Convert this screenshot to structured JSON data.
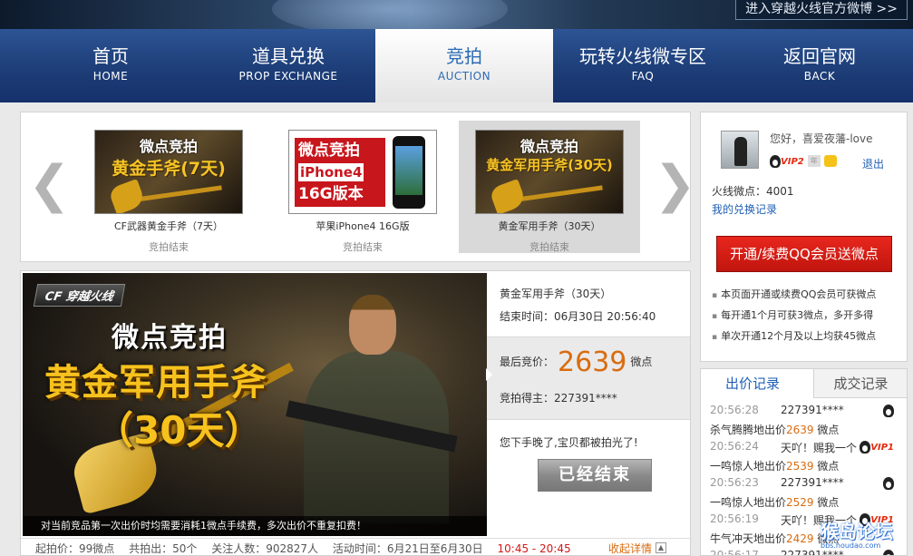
{
  "banner": {
    "weibo_link": "进入穿越火线官方微博 >>"
  },
  "nav": {
    "items": [
      {
        "zh": "首页",
        "en": "HOME"
      },
      {
        "zh": "道具兑换",
        "en": "PROP EXCHANGE"
      },
      {
        "zh": "竞拍",
        "en": "AUCTION"
      },
      {
        "zh": "玩转火线微专区",
        "en": "FAQ"
      },
      {
        "zh": "返回官网",
        "en": "BACK"
      }
    ],
    "active_index": 2
  },
  "products": [
    {
      "thumb_title": "微点竞拍",
      "thumb_sub": "黄金手斧(7天)",
      "name": "CF武器黄金手斧（7天）",
      "status": "竞拍结束"
    },
    {
      "thumb_title": "微点竞拍",
      "thumb_l2": "iPhone4",
      "thumb_l3": "16G版本",
      "name": "苹果iPhone4 16G版",
      "status": "竞拍结束"
    },
    {
      "thumb_title": "微点竞拍",
      "thumb_sub": "黄金军用手斧(30天)",
      "name": "黄金军用手斧（30天）",
      "status": "竞拍结束"
    }
  ],
  "hero": {
    "logo": "CF 穿越火线",
    "line1": "微点竞拍",
    "line2": "黄金军用手斧",
    "line3": "（30天）",
    "notice": "对当前竞品第一次出价时均需要消耗1微点手续费，多次出价不重复扣费！"
  },
  "info": {
    "item_name": "黄金军用手斧（30天）",
    "end_time": "结束时间：06月30日 20:56:40",
    "last_bid_label": "最后竞价：",
    "last_bid_value": "2639",
    "last_bid_unit": "微点",
    "winner": "竞拍得主：227391****",
    "late_msg": "您下手晚了,宝贝都被拍光了!",
    "ended_button": "已经结束"
  },
  "bottom_bar": {
    "start_price": "起拍价：99微点",
    "total_bids": "共拍出：50个",
    "watchers": "关注人数：902827人",
    "activity_label": "活动时间：6月21日至6月30日",
    "activity_hours": "10:45 - 20:45",
    "more": "收起详情",
    "more_icon": "▲"
  },
  "user": {
    "greeting": "您好，喜爱夜藩-love",
    "vip": "VIP2",
    "nian_badge": "年",
    "logout": "退出",
    "points": "火线微点：4001",
    "redeem_link": "我的兑换记录",
    "qq_button": "开通/续费QQ会员送微点",
    "tips": [
      "本页面开通或续费QQ会员可获微点",
      "每开通1个月可获3微点，多开多得",
      "单次开通12个月及以上均获45微点"
    ]
  },
  "records": {
    "tab_bids": "出价记录",
    "tab_deals": "成交记录",
    "items": [
      {
        "time": "20:56:28",
        "who": "227391****",
        "badge": "",
        "msg_pre": "杀气腾腾地出价",
        "price": "2639",
        "msg_post": " 微点"
      },
      {
        "time": "20:56:24",
        "who": "天吖！赐我一个",
        "badge": "VIP1",
        "msg_pre": "一鸣惊人地出价",
        "price": "2539",
        "msg_post": " 微点"
      },
      {
        "time": "20:56:23",
        "who": "227391****",
        "badge": "",
        "msg_pre": "一鸣惊人地出价",
        "price": "2529",
        "msg_post": " 微点"
      },
      {
        "time": "20:56:19",
        "who": "天吖！赐我一个",
        "badge": "VIP1",
        "msg_pre": "牛气冲天地出价",
        "price": "2429",
        "msg_post": " 微点"
      },
      {
        "time": "20:56:17",
        "who": "227391****",
        "badge": "",
        "msg_pre": "",
        "price": "",
        "msg_post": ""
      }
    ]
  },
  "watermark": {
    "main": "猴岛论坛",
    "sub": "bbs.houdao.com"
  }
}
